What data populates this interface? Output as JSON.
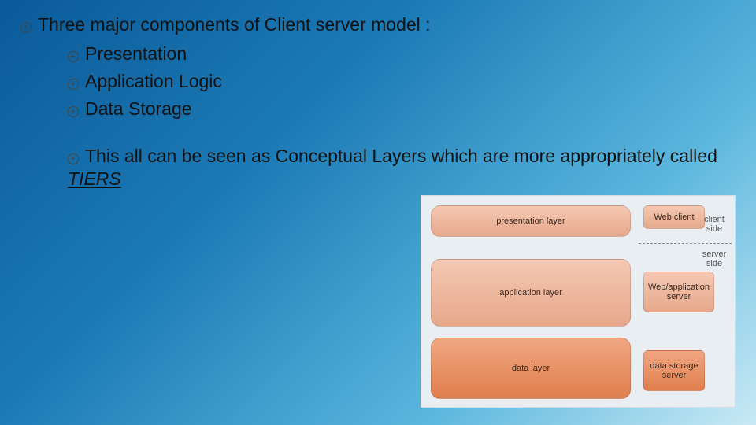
{
  "main": {
    "heading": "Three major components of Client server model :",
    "items": [
      "Presentation",
      "Application Logic",
      "Data Storage"
    ],
    "para_before": "This all can be seen as Conceptual Layers which are more appropriately called ",
    "para_em": "TIERS"
  },
  "diagram": {
    "layers": [
      "presentation layer",
      "application layer",
      "data layer"
    ],
    "boxes": [
      "Web client",
      "Web/application server",
      "data storage server"
    ],
    "annot": [
      "client side",
      "server side"
    ]
  }
}
